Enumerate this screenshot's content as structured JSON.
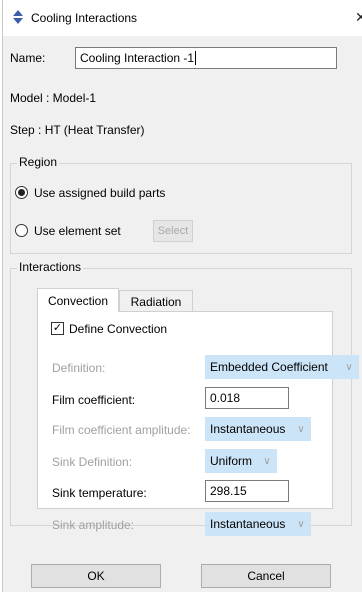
{
  "window": {
    "title": "Cooling Interactions"
  },
  "form": {
    "name_label": "Name:",
    "name_value": "Cooling Interaction -1",
    "model_text": "Model : Model-1",
    "step_text": "Step  : HT (Heat Transfer)"
  },
  "region": {
    "title": "Region",
    "option_assigned": "Use assigned build parts",
    "option_element_set": "Use element set",
    "select_label": "Select"
  },
  "interactions": {
    "title": "Interactions",
    "tabs": [
      "Convection",
      "Radiation"
    ],
    "define_convection_label": "Define Convection",
    "define_convection_checked": true,
    "fields": {
      "definition": {
        "label": "Definition:",
        "value": "Embedded Coefficient"
      },
      "film_coefficient": {
        "label": "Film coefficient:",
        "value": "0.018"
      },
      "film_amplitude": {
        "label": "Film coefficient amplitude:",
        "value": "Instantaneous"
      },
      "sink_definition": {
        "label": "Sink Definition:",
        "value": "Uniform"
      },
      "sink_temperature": {
        "label": "Sink temperature:",
        "value": "298.15"
      },
      "sink_amplitude": {
        "label": "Sink amplitude:",
        "value": "Instantaneous"
      }
    }
  },
  "buttons": {
    "ok": "OK",
    "cancel": "Cancel"
  },
  "colors": {
    "combo_bg": "#cce4f7",
    "dialog_bg": "#f0f0f0"
  }
}
